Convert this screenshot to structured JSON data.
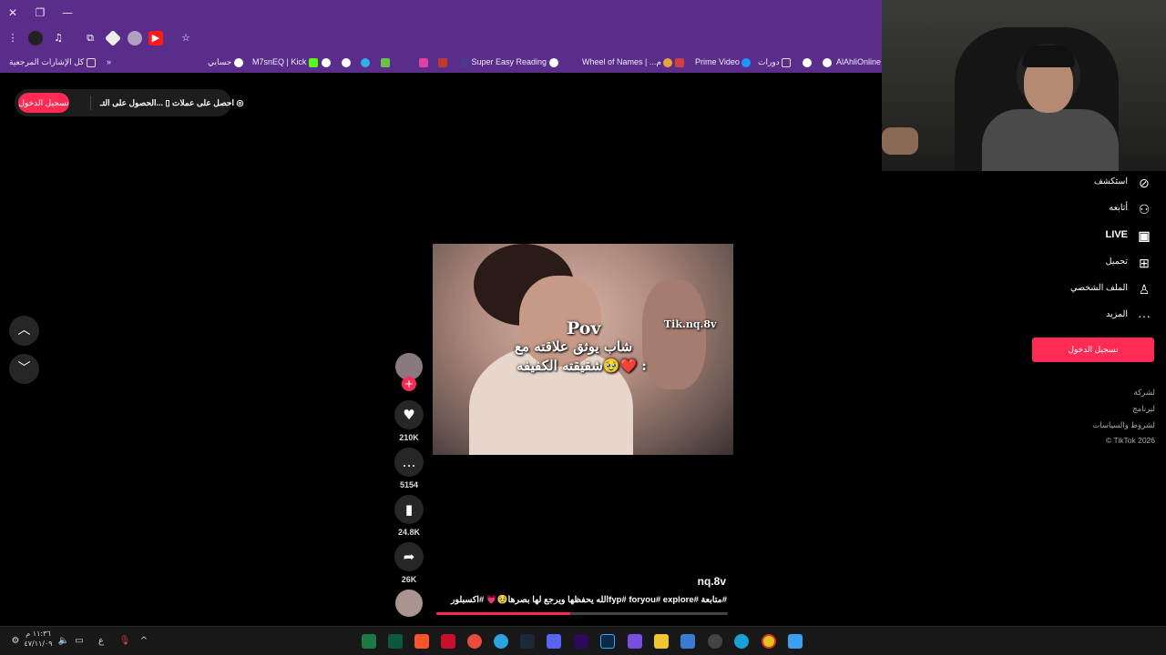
{
  "browser": {
    "bookmarks": {
      "all_bookmarks": "كل الإشارات المرجعية",
      "items": [
        "حسابي",
        "M7snEQ | Kick",
        "Super Easy Reading",
        "Wheel of Names | ...م",
        "Prime Video",
        "دورات",
        "AlAhliOnline"
      ]
    }
  },
  "top_bar": {
    "login": "تسجيل الدخول",
    "get_app": "الحصول على التـ...",
    "get_coins": "احصل على عملات"
  },
  "video": {
    "overlay_pov": "Pov",
    "overlay_watermark": "Tik.nq.8v",
    "overlay_line1": "شاب يوثق علاقته مع",
    "overlay_line2": "شقيقته الكفيفه🥹❤️ :"
  },
  "actions": {
    "likes": "210K",
    "comments": "5154",
    "saves": "24.8K",
    "shares": "26K"
  },
  "caption": {
    "username": "nq.8v",
    "text": "الله يحفظها ويرجع لها بصرها🥹💗 #اكسبلورfyp# foryou# explore# متابعة#",
    "progress": 0.46
  },
  "sidebar": {
    "explore": "استكشف",
    "following": "ﺃﺗﺎﺑﻌﻪ",
    "live": "LIVE",
    "upload": "تحميل",
    "profile": "الملف الشخصي",
    "more": "المزيد",
    "login_button": "تسجيل الدخول",
    "footer_company": "لشركة",
    "footer_program": "لبرنامج",
    "footer_terms": "لشروط والسياسات",
    "copyright": "© TikTok 2026"
  },
  "taskbar": {
    "lang": "ع",
    "time": "١١:٣٦ م",
    "date": "٤٧/١١/٠٩"
  },
  "colors": {
    "accent": "#fe2c55",
    "browser_frame": "#5a2d8a"
  }
}
